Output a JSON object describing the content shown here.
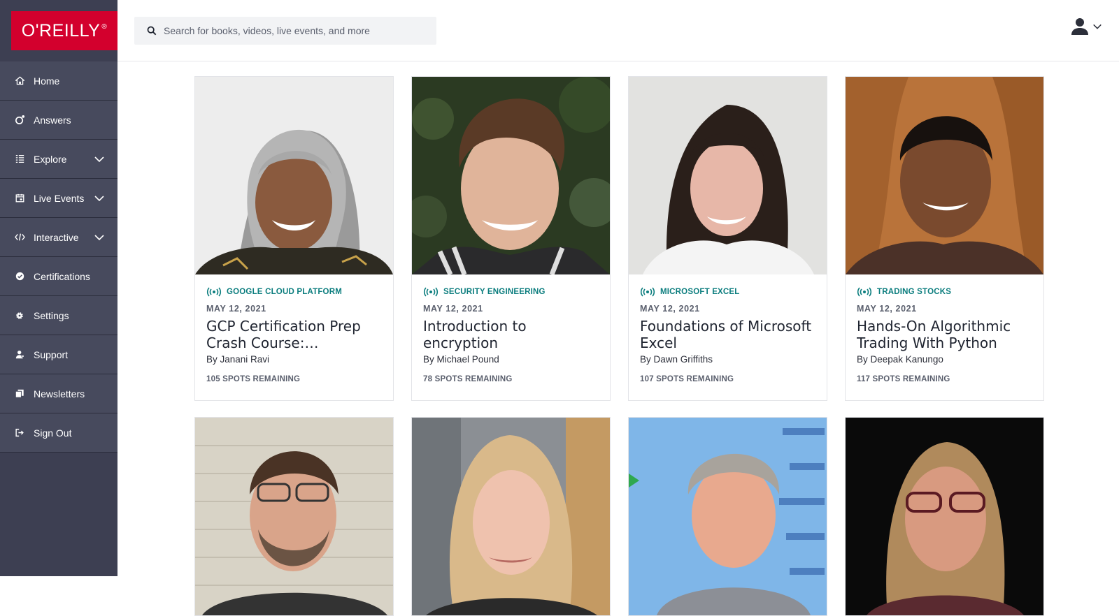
{
  "brand": {
    "logo_text": "O'REILLY",
    "registered": "®",
    "color": "#d3002d"
  },
  "search": {
    "placeholder": "Search for books, videos, live events, and more"
  },
  "sidebar": {
    "items": [
      {
        "label": "Home",
        "icon": "home-icon"
      },
      {
        "label": "Answers",
        "icon": "answers-icon"
      },
      {
        "label": "Explore",
        "icon": "explore-icon",
        "expandable": true
      },
      {
        "label": "Live Events",
        "icon": "calendar-icon",
        "expandable": true
      },
      {
        "label": "Interactive",
        "icon": "code-icon",
        "expandable": true
      },
      {
        "label": "Certifications",
        "icon": "badge-icon"
      },
      {
        "label": "Settings",
        "icon": "gear-icon"
      },
      {
        "label": "Support",
        "icon": "support-icon"
      },
      {
        "label": "Newsletters",
        "icon": "newsletter-icon"
      },
      {
        "label": "Sign Out",
        "icon": "sign-out-icon"
      }
    ]
  },
  "events": [
    {
      "topic": "GOOGLE CLOUD PLATFORM",
      "date": "MAY 12, 2021",
      "title": "GCP Certification Prep Crash Course: Professional Cloud Architect",
      "author": "By Janani Ravi",
      "spots": "105 SPOTS REMAINING"
    },
    {
      "topic": "SECURITY ENGINEERING",
      "date": "MAY 12, 2021",
      "title": "Introduction to encryption",
      "author": "By Michael Pound",
      "spots": "78 SPOTS REMAINING"
    },
    {
      "topic": "MICROSOFT EXCEL",
      "date": "MAY 12, 2021",
      "title": "Foundations of Microsoft Excel",
      "author": "By Dawn Griffiths",
      "spots": "107 SPOTS REMAINING"
    },
    {
      "topic": "TRADING STOCKS",
      "date": "MAY 12, 2021",
      "title": "Hands-On Algorithmic Trading With Python",
      "author": "By Deepak Kanungo",
      "spots": "117 SPOTS REMAINING"
    }
  ],
  "colors": {
    "sidebar_bg": "#3d3f52",
    "sidebar_item_bg": "#474a5d",
    "topic_teal": "#0b7d7e"
  }
}
